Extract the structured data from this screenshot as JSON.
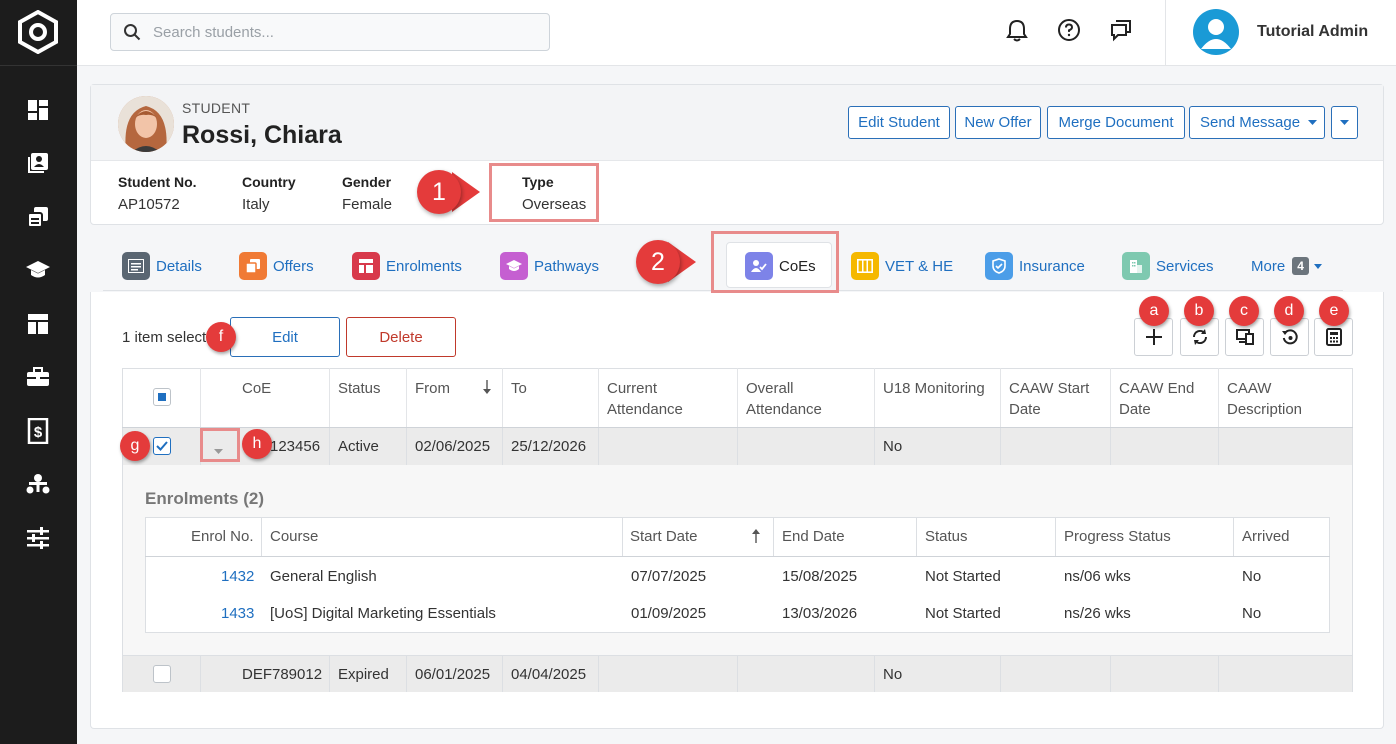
{
  "topbar": {
    "search_placeholder": "Search students...",
    "user_name": "Tutorial Admin"
  },
  "student": {
    "label": "STUDENT",
    "name": "Rossi, Chiara",
    "fields": [
      {
        "label": "Student No.",
        "value": "AP10572"
      },
      {
        "label": "Country",
        "value": "Italy"
      },
      {
        "label": "Gender",
        "value": "Female"
      },
      {
        "label": "Type",
        "value": "Overseas"
      }
    ],
    "actions": {
      "edit_student": "Edit Student",
      "new_offer": "New Offer",
      "merge_document": "Merge Document",
      "send_message": "Send Message"
    }
  },
  "tabs": [
    {
      "label": "Details"
    },
    {
      "label": "Offers"
    },
    {
      "label": "Enrolments"
    },
    {
      "label": "Pathways"
    },
    {
      "label": "CoEs"
    },
    {
      "label": "VET & HE"
    },
    {
      "label": "Insurance"
    },
    {
      "label": "Services"
    },
    {
      "label": "More",
      "badge": "4"
    }
  ],
  "callouts": {
    "one": "1",
    "two": "2",
    "a": "a",
    "b": "b",
    "c": "c",
    "d": "d",
    "e": "e",
    "f": "f",
    "g": "g",
    "h": "h"
  },
  "toolbar": {
    "selected_text": "1 item select",
    "edit_label": "Edit",
    "delete_label": "Delete"
  },
  "coe_table": {
    "columns": [
      "CoE",
      "Status",
      "From",
      "To",
      "Current Attendance",
      "Overall Attendance",
      "U18 Monitoring",
      "CAAW Start Date",
      "CAAW End Date",
      "CAAW Description"
    ],
    "rows": [
      {
        "coe": "123456",
        "status": "Active",
        "from": "02/06/2025",
        "to": "25/12/2026",
        "u18": "No"
      },
      {
        "coe": "DEF789012",
        "status": "Expired",
        "from": "06/01/2025",
        "to": "04/04/2025",
        "u18": "No"
      }
    ]
  },
  "enrolments": {
    "title": "Enrolments (2)",
    "columns": [
      "Enrol No.",
      "Course",
      "Start Date",
      "End Date",
      "Status",
      "Progress Status",
      "Arrived"
    ],
    "rows": [
      {
        "no": "1432",
        "course": "General English",
        "start": "07/07/2025",
        "end": "15/08/2025",
        "status": "Not Started",
        "progress": "ns/06 wks",
        "arrived": "No"
      },
      {
        "no": "1433",
        "course": "[UoS] Digital Marketing Essentials",
        "start": "01/09/2025",
        "end": "13/03/2026",
        "status": "Not Started",
        "progress": "ns/26 wks",
        "arrived": "No"
      }
    ]
  },
  "colors": {
    "accent": "#1f6fc0",
    "callout": "#e43b3b",
    "danger": "#c0392b"
  }
}
